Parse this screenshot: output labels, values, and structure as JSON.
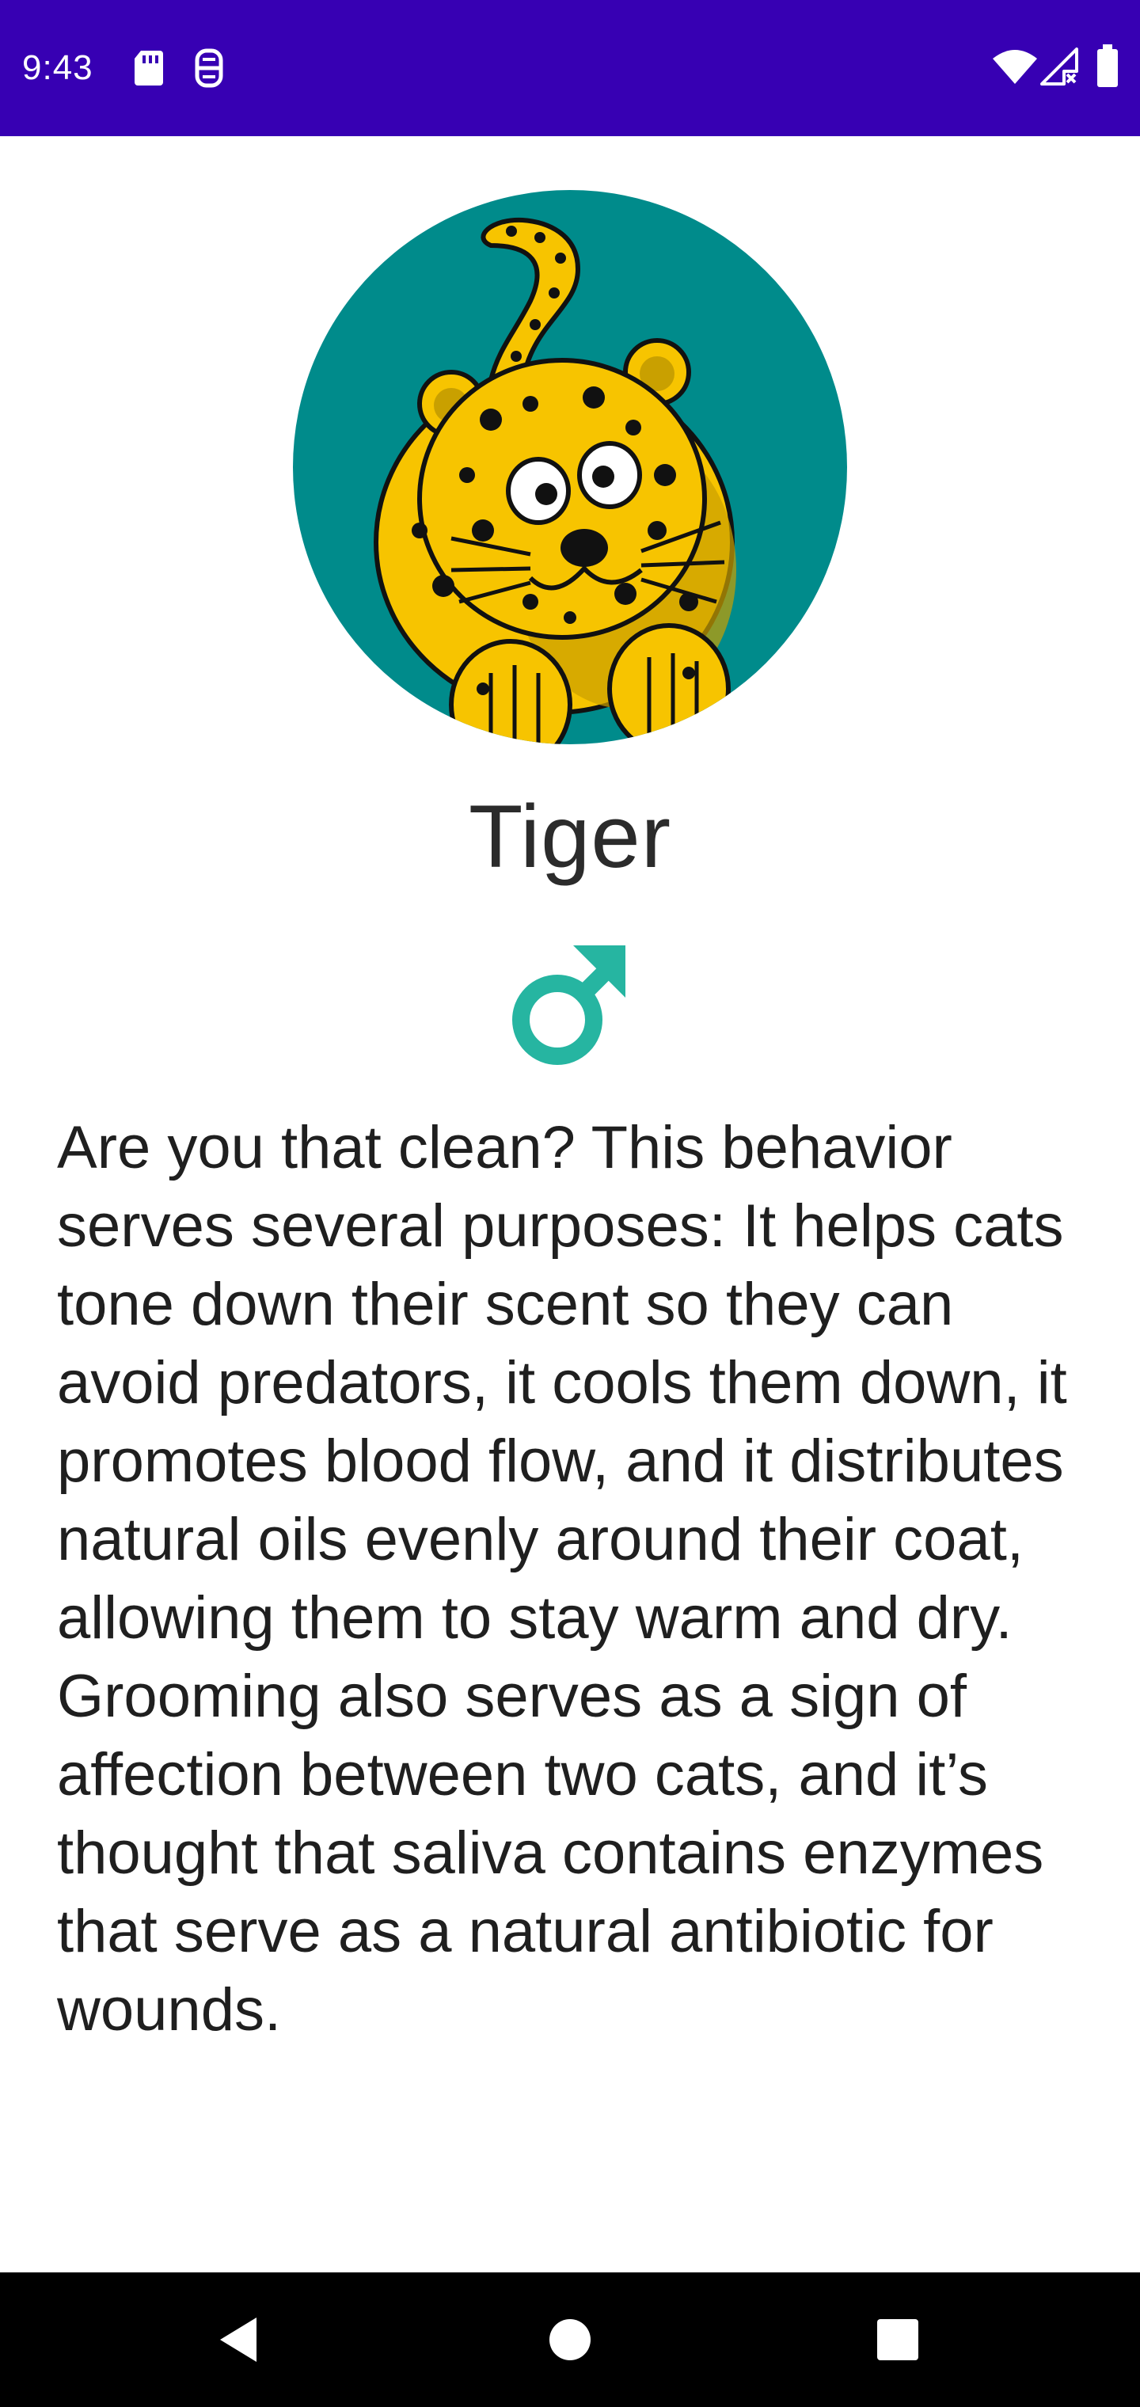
{
  "status_bar": {
    "time": "9:43",
    "left_icons": [
      "sd-card-icon",
      "accessibility-icon"
    ],
    "right_icons": [
      "wifi-icon",
      "signal-icon",
      "battery-icon"
    ],
    "background_color": "#3700b3"
  },
  "pet": {
    "image_icon": "cartoon-leopard-icon",
    "image_background_color": "#008b8b",
    "name": "Tiger",
    "gender_icon": "male-symbol-icon",
    "gender_color": "#26b5a1",
    "description": "Are you that clean? This behavior serves several purposes: It helps cats tone down their scent so they can avoid predators, it cools them down, it promotes blood flow, and it distributes natural oils evenly around their coat, allowing them to stay warm and dry. Grooming also serves as a sign of affection between two cats, and it’s thought that saliva contains enzymes that serve as a natural antibiotic for wounds."
  },
  "nav_bar": {
    "buttons": [
      "back-icon",
      "home-icon",
      "recents-icon"
    ]
  }
}
